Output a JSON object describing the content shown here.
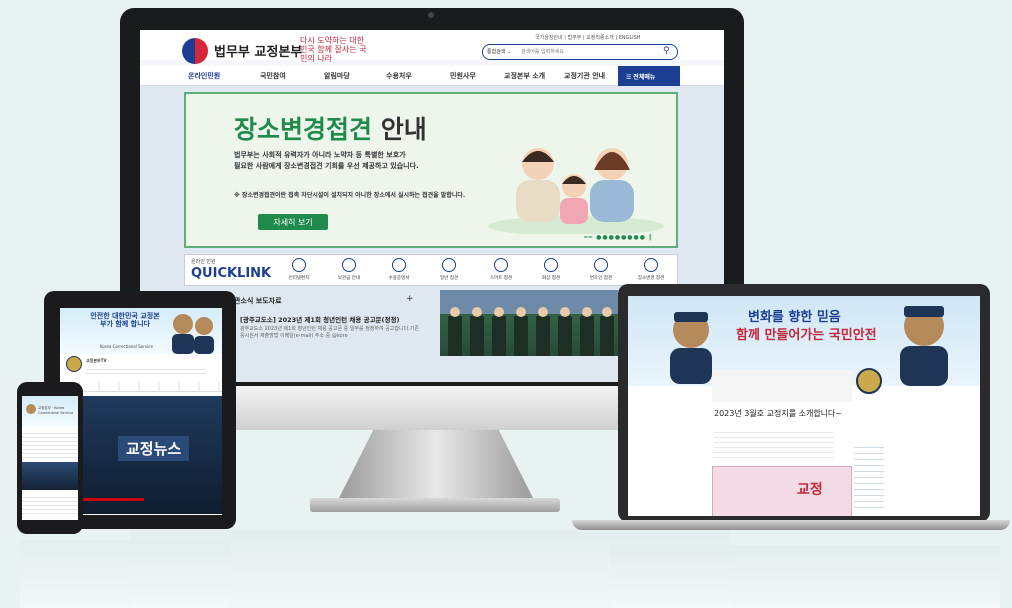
{
  "monitor": {
    "brand": "법무부 교정본부",
    "slogan": "다시 도약하는 대한민국 함께 잘사는 국민의 나라",
    "util_links": "국가상징안내 | 법무부 | 교정직종소개 | ENGLISH",
    "search": {
      "select": "통합검색 ⌄",
      "placeholder": "검색어를 입력하세요"
    },
    "nav": [
      "온라인민원",
      "국민참여",
      "알림마당",
      "수용처우",
      "민원사무",
      "교정본부 소개",
      "교정기관 안내"
    ],
    "nav_all": "전체메뉴",
    "banner": {
      "title_green": "장소변경접견",
      "title_dark": "안내",
      "line1": "법무부는 사회적 유력자가 아니라 노약자 등 특별한 보호가",
      "line2": "필요한 사람에게 장소변경접견 기회를 우선 제공하고 있습니다.",
      "note": "※ 장소변경접견이란 접촉 차단시설이 설치되지 아니한 장소에서 실시하는 접견을 말합니다.",
      "button": "자세히 보기"
    },
    "quicklink": {
      "small": "온라인 민원",
      "big": "QUICKLINK",
      "items": [
        "인터넷편지",
        "보관금 안내",
        "수용증명서",
        "일반 접견",
        "스마트 접견",
        "화상 접견",
        "변호인 접견",
        "장소변경 접견"
      ]
    },
    "news": {
      "tabs": "관소식  보도자료",
      "title": "[광주교도소] 2023년 제1회 청년인턴 채용 공고문(정정)",
      "body": "광주교도소 2023년 제1회 청년인턴 채용 공고문 중 일부를 정정하여 공고합니다.기존 응시원서 제출방법 이메일(e-mail) 주소 중 @kore"
    }
  },
  "laptop": {
    "banner_line1": "변화를 향한 믿음",
    "banner_line2": "함께 만들어가는 국민안전",
    "post_title": "2023년 3월호 교정지를 소개합니다~",
    "magazine": "교정"
  },
  "tablet": {
    "banner": "안전한 대한민국 교정본부가 함께 합니다",
    "banner_en": "Korea Correctional Service",
    "channel": "교정본부TV",
    "news_badge": "교정뉴스"
  },
  "phone": {
    "caption": "교정본부 · Korea Correctional Service"
  }
}
